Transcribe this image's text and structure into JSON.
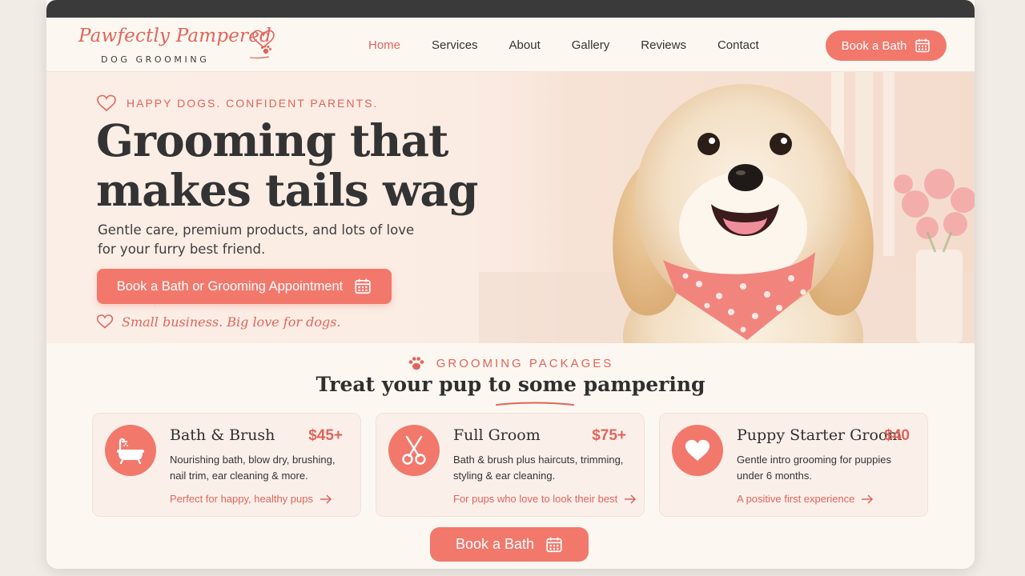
{
  "brand": {
    "name": "Pawfectly Pampered",
    "tagline": "DOG GROOMING",
    "accent": "#f2786c",
    "accent_text": "#e0645b"
  },
  "nav": {
    "items": [
      {
        "label": "Home",
        "active": true
      },
      {
        "label": "Services",
        "active": false
      },
      {
        "label": "About",
        "active": false
      },
      {
        "label": "Gallery",
        "active": false
      },
      {
        "label": "Reviews",
        "active": false
      },
      {
        "label": "Contact",
        "active": false
      }
    ],
    "cta_label": "Book a Bath",
    "cta_icon": "calendar-icon"
  },
  "hero": {
    "eyebrow": "HAPPY DOGS. CONFIDENT PARENTS.",
    "eyebrow_icon": "heart-outline-icon",
    "title_line1": "Grooming that",
    "title_line2": "makes tails wag",
    "subtitle_line1": "Gentle care, premium products, and lots of love",
    "subtitle_line2": "for your furry best friend.",
    "cta_label": "Book a Bath or Grooming Appointment",
    "cta_icon": "calendar-icon",
    "note": "Small business. Big love for dogs.",
    "note_icon": "heart-outline-icon",
    "image": "fluffy-dog-with-pink-bandana"
  },
  "packages": {
    "eyebrow": "GROOMING PACKAGES",
    "eyebrow_icon": "paw-icon",
    "title": "Treat your pup to some pampering",
    "items": [
      {
        "name": "Bath & Brush",
        "price": "$45+",
        "icon": "bathtub-icon",
        "desc": "Nourishing bath, blow dry, brushing, nail trim, ear cleaning & more.",
        "link": "Perfect for happy, healthy pups"
      },
      {
        "name": "Full Groom",
        "price": "$75+",
        "icon": "scissors-icon",
        "desc": "Bath & brush plus haircuts, trimming, styling & ear cleaning.",
        "link": "For pups who love to look their best"
      },
      {
        "name": "Puppy Starter Groom",
        "price": "$40",
        "icon": "heart-icon",
        "desc": "Gentle intro grooming for puppies under 6 months.",
        "link": "A positive first experience"
      }
    ]
  },
  "bottom_cta": {
    "label": "Book a Bath",
    "icon": "calendar-icon"
  }
}
